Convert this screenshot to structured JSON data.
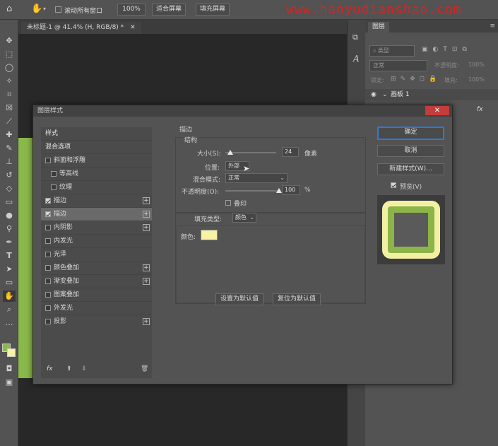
{
  "options_bar": {
    "scroll_all_windows": "滚动所有窗口",
    "zoom_100": "100%",
    "fit_screen": "适合屏幕",
    "fill_screen": "填充屏幕",
    "watermark": "www.hanyudianshao.com"
  },
  "document": {
    "tab_title": "未标题-1 @ 41.4% (H, RGB/8) *"
  },
  "layers_panel": {
    "tab_label": "图层",
    "search_kind": "类型",
    "blend_mode": "正常",
    "opacity_label": "不透明度:",
    "opacity_value": "100%",
    "lock_label": "锁定:",
    "fill_label": "填充:",
    "fill_value": "100%",
    "artboard_name": "画板 1",
    "fx_label": "fx"
  },
  "dialog": {
    "title": "图层样式",
    "close_glyph": "✕",
    "fx_list": {
      "styles": "样式",
      "blend_options": "混合选项",
      "bevel_emboss": "斜面和浮雕",
      "contour": "等高线",
      "texture": "纹理",
      "stroke_1": "描边",
      "stroke_2": "描边",
      "inner_shadow": "内阴影",
      "inner_glow": "内发光",
      "satin": "光泽",
      "color_overlay": "颜色叠加",
      "gradient_overlay": "渐变叠加",
      "pattern_overlay": "图案叠加",
      "outer_glow": "外发光",
      "drop_shadow": "投影",
      "footer_fx": "fx"
    },
    "stroke": {
      "section_title": "描边",
      "structure_title": "结构",
      "size_label": "大小(S):",
      "size_value": "24",
      "size_unit": "像素",
      "size_level": 0.1,
      "position_label": "位置:",
      "position_value": "外部",
      "blend_label": "混合模式:",
      "blend_value": "正常",
      "opacity_label": "不透明度(O):",
      "opacity_value": "100",
      "opacity_unit": "%",
      "opacity_level": 1.0,
      "overprint_label": "叠印",
      "fill_type_label": "填充类型:",
      "fill_type_value": "颜色",
      "color_label": "颜色:",
      "stroke_color": "#f7f2a6",
      "make_default": "设置为默认值",
      "reset_default": "复位为默认值"
    },
    "buttons": {
      "ok": "确定",
      "cancel": "取消",
      "new_style": "新建样式(W)...",
      "preview": "预览(V)"
    },
    "preview_colors": {
      "outer": "#f3f0a4",
      "inner": "#8cb448",
      "center": "#5a5a5a"
    }
  }
}
